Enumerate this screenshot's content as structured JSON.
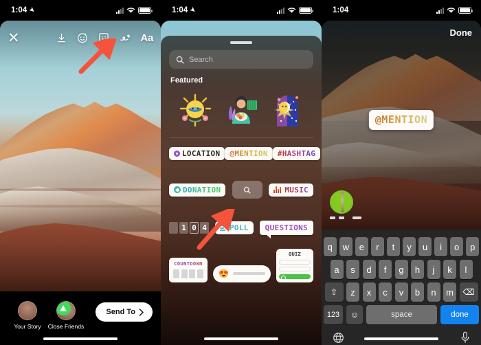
{
  "panels": [
    {
      "id": "story-editor",
      "status": {
        "time": "1:04",
        "location_arrow": "location-arrow-icon",
        "signal": "cellular-signal-icon",
        "wifi": "wifi-icon",
        "battery": "battery-icon"
      },
      "close_label": "✕",
      "tools": [
        {
          "name": "download-icon",
          "label": "Download"
        },
        {
          "name": "effects-icon",
          "label": "Effects"
        },
        {
          "name": "sticker-icon",
          "label": "Stickers"
        },
        {
          "name": "draw-icon",
          "label": "Draw"
        },
        {
          "name": "text-icon",
          "label": "Aa"
        }
      ],
      "annotation": {
        "name": "red-arrow-annotation",
        "points_to": "sticker-icon"
      },
      "audience": [
        {
          "label": "Your Story",
          "avatar": "your-story-avatar"
        },
        {
          "label": "Close Friends",
          "avatar": "close-friends-avatar",
          "badge": "close-friends-badge"
        }
      ],
      "send_to": {
        "label": "Send To",
        "chevron": "chevron-right-icon"
      }
    },
    {
      "id": "sticker-tray",
      "status": {
        "time": "1:04"
      },
      "grabber": "drag-handle",
      "search": {
        "placeholder": "Search",
        "icon": "search-icon"
      },
      "section_title": "Featured",
      "featured_stickers": [
        {
          "name": "sun-bird-flowers-sticker"
        },
        {
          "name": "woman-with-plants-sticker"
        },
        {
          "name": "sun-moon-celestial-sticker"
        }
      ],
      "sticker_buttons_row1": [
        {
          "label": "LOCATION",
          "name": "location-sticker",
          "icon": "location-pin-icon"
        },
        {
          "label": "@MENTION",
          "name": "mention-sticker"
        },
        {
          "label": "#HASHTAG",
          "name": "hashtag-sticker"
        }
      ],
      "sticker_buttons_row2": [
        {
          "label": "DONATION",
          "name": "donation-sticker",
          "icon": "heart-icon"
        },
        {
          "label": "",
          "name": "gif-search-sticker",
          "icon": "search-icon"
        },
        {
          "label": "MUSIC",
          "name": "music-sticker",
          "icon": "equalizer-icon"
        }
      ],
      "sticker_buttons_row3": [
        {
          "label": "104",
          "name": "countdown-number-sticker"
        },
        {
          "label": "POLL",
          "name": "poll-sticker",
          "icon": "poll-bars-icon"
        },
        {
          "label": "QUESTIONS",
          "name": "questions-sticker"
        }
      ],
      "sticker_buttons_row4": [
        {
          "label": "COUNTDOWN",
          "name": "countdown-sticker"
        },
        {
          "label": "",
          "name": "emoji-slider-sticker",
          "emoji": "😍"
        },
        {
          "label": "QUIZ",
          "name": "quiz-sticker"
        }
      ],
      "annotation": {
        "name": "red-arrow-annotation",
        "points_to": "mention-sticker"
      }
    },
    {
      "id": "mention-placed",
      "status": {
        "time": "1:04"
      },
      "done_label": "Done",
      "placed_sticker": {
        "text": "@MENTION",
        "name": "mention-sticker-placed"
      },
      "suggestion": {
        "name": "mention-suggestion-avatar"
      },
      "keyboard": {
        "row1": [
          "q",
          "w",
          "e",
          "r",
          "t",
          "y",
          "u",
          "i",
          "o",
          "p"
        ],
        "row2": [
          "a",
          "s",
          "d",
          "f",
          "g",
          "h",
          "j",
          "k",
          "l"
        ],
        "row3_shift": "⇧",
        "row3": [
          "z",
          "x",
          "c",
          "v",
          "b",
          "n",
          "m"
        ],
        "row3_delete": "⌫",
        "numbers_key": "123",
        "emoji_key": "☺",
        "space_key": "space",
        "done_key": "done",
        "globe_key": "globe-icon",
        "mic_key": "microphone-icon"
      }
    }
  ]
}
